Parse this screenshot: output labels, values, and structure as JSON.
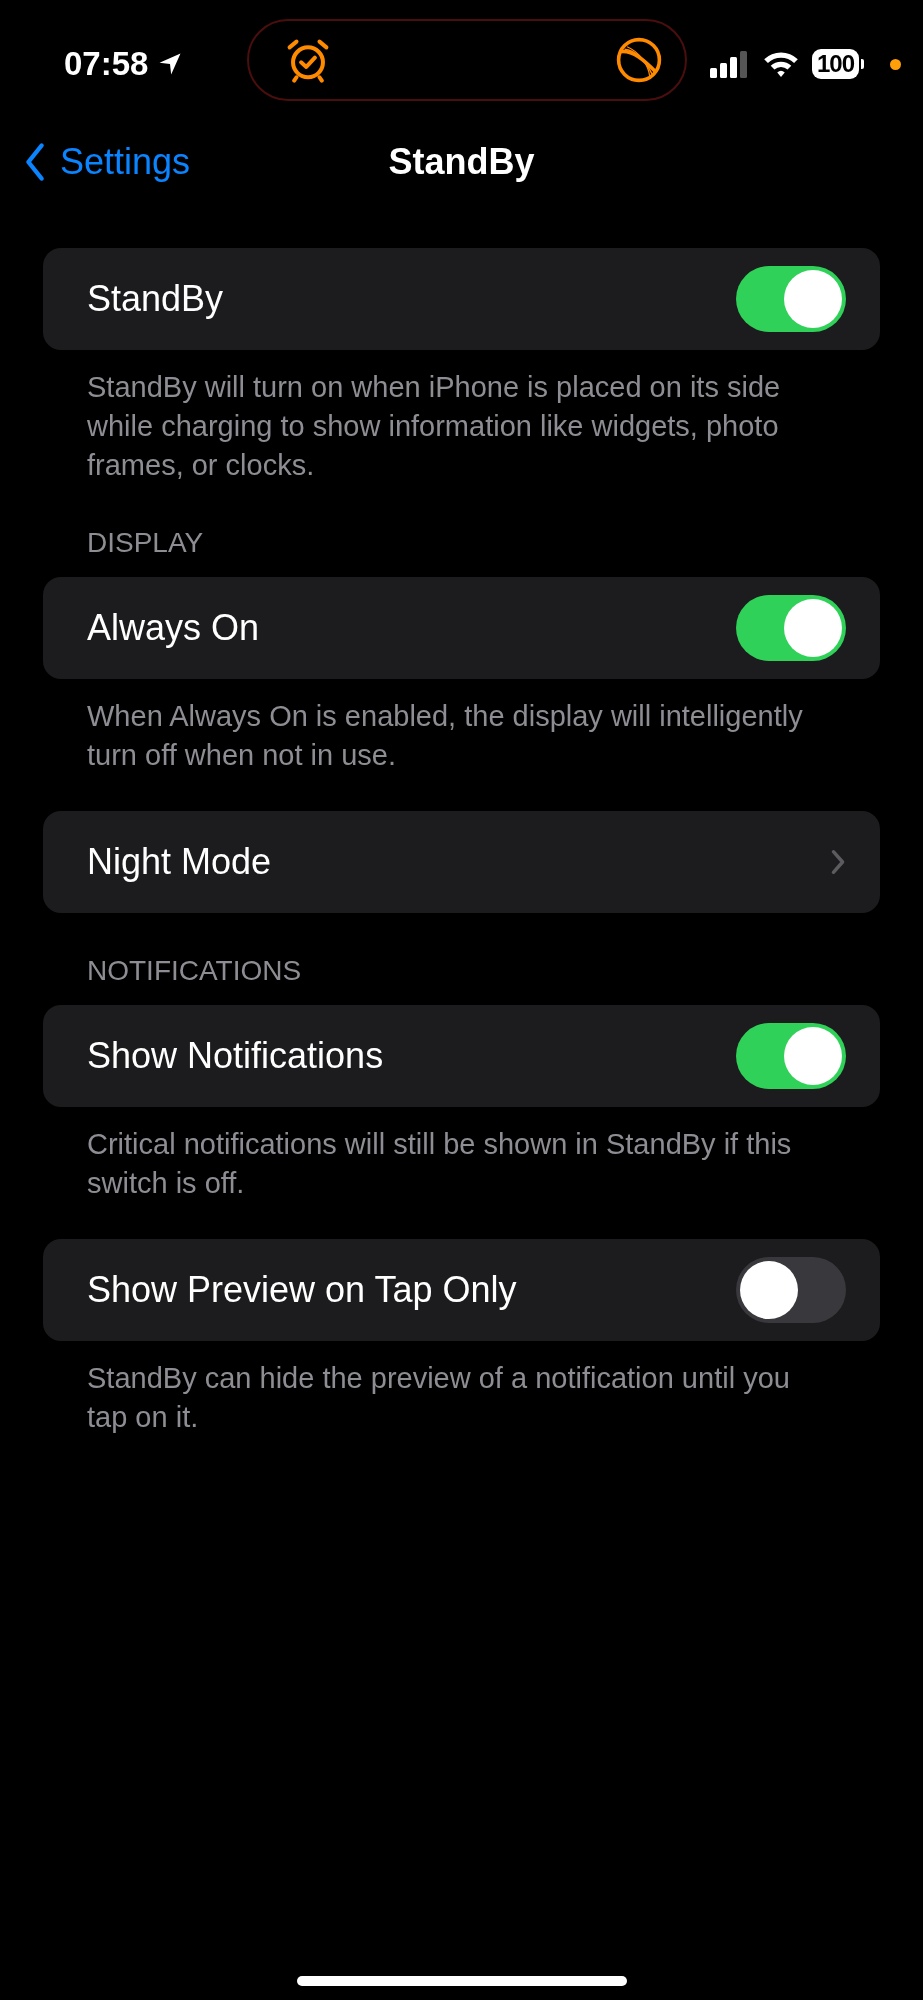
{
  "status_bar": {
    "time": "07:58",
    "battery": "100"
  },
  "nav": {
    "back": "Settings",
    "title": "StandBy"
  },
  "groups": [
    {
      "rows": [
        {
          "kind": "toggle",
          "label": "StandBy",
          "on": true
        }
      ],
      "footer": "StandBy will turn on when iPhone is placed on its side while charging to show information like widgets, photo frames, or clocks."
    },
    {
      "header": "DISPLAY",
      "rows": [
        {
          "kind": "toggle",
          "label": "Always On",
          "on": true
        }
      ],
      "footer": "When Always On is enabled, the display will intelligently turn off when not in use."
    },
    {
      "rows": [
        {
          "kind": "link",
          "label": "Night Mode"
        }
      ]
    },
    {
      "header": "NOTIFICATIONS",
      "rows": [
        {
          "kind": "toggle",
          "label": "Show Notifications",
          "on": true
        }
      ],
      "footer": "Critical notifications will still be shown in StandBy if this switch is off."
    },
    {
      "rows": [
        {
          "kind": "toggle",
          "label": "Show Preview on Tap Only",
          "on": false
        }
      ],
      "footer": "StandBy can hide the preview of a notification until you tap on it."
    }
  ]
}
